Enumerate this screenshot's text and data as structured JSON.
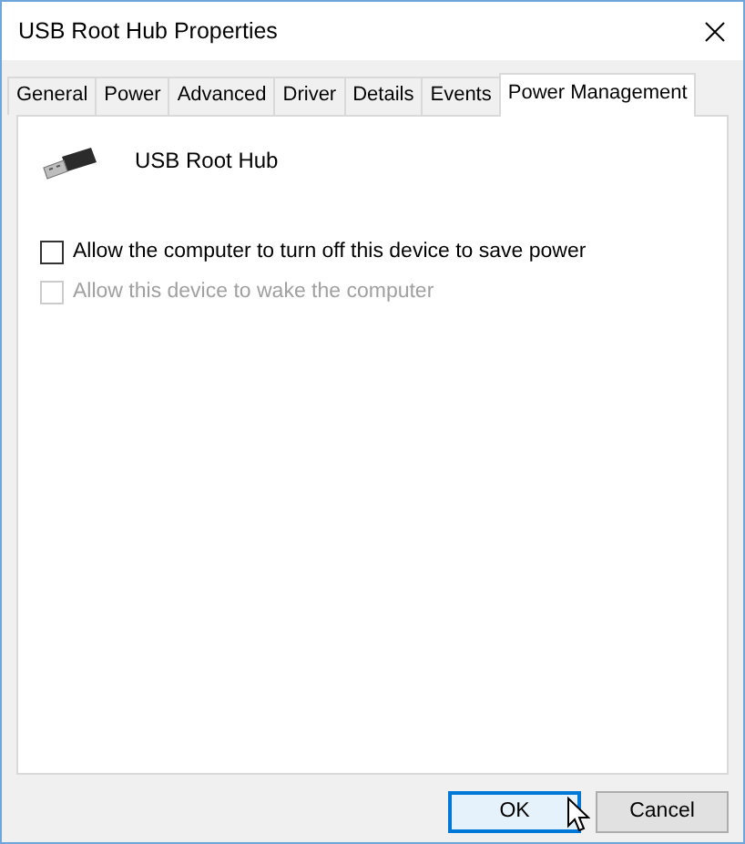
{
  "window": {
    "title": "USB Root Hub Properties"
  },
  "tabs": [
    {
      "label": "General",
      "selected": false
    },
    {
      "label": "Power",
      "selected": false
    },
    {
      "label": "Advanced",
      "selected": false
    },
    {
      "label": "Driver",
      "selected": false
    },
    {
      "label": "Details",
      "selected": false
    },
    {
      "label": "Events",
      "selected": false
    },
    {
      "label": "Power Management",
      "selected": true
    }
  ],
  "device": {
    "name": "USB Root Hub"
  },
  "options": [
    {
      "label": "Allow the computer to turn off this device to save power",
      "checked": false,
      "disabled": false
    },
    {
      "label": "Allow this device to wake the computer",
      "checked": false,
      "disabled": true
    }
  ],
  "buttons": [
    {
      "label": "OK",
      "default": true
    },
    {
      "label": "Cancel",
      "default": false
    }
  ]
}
